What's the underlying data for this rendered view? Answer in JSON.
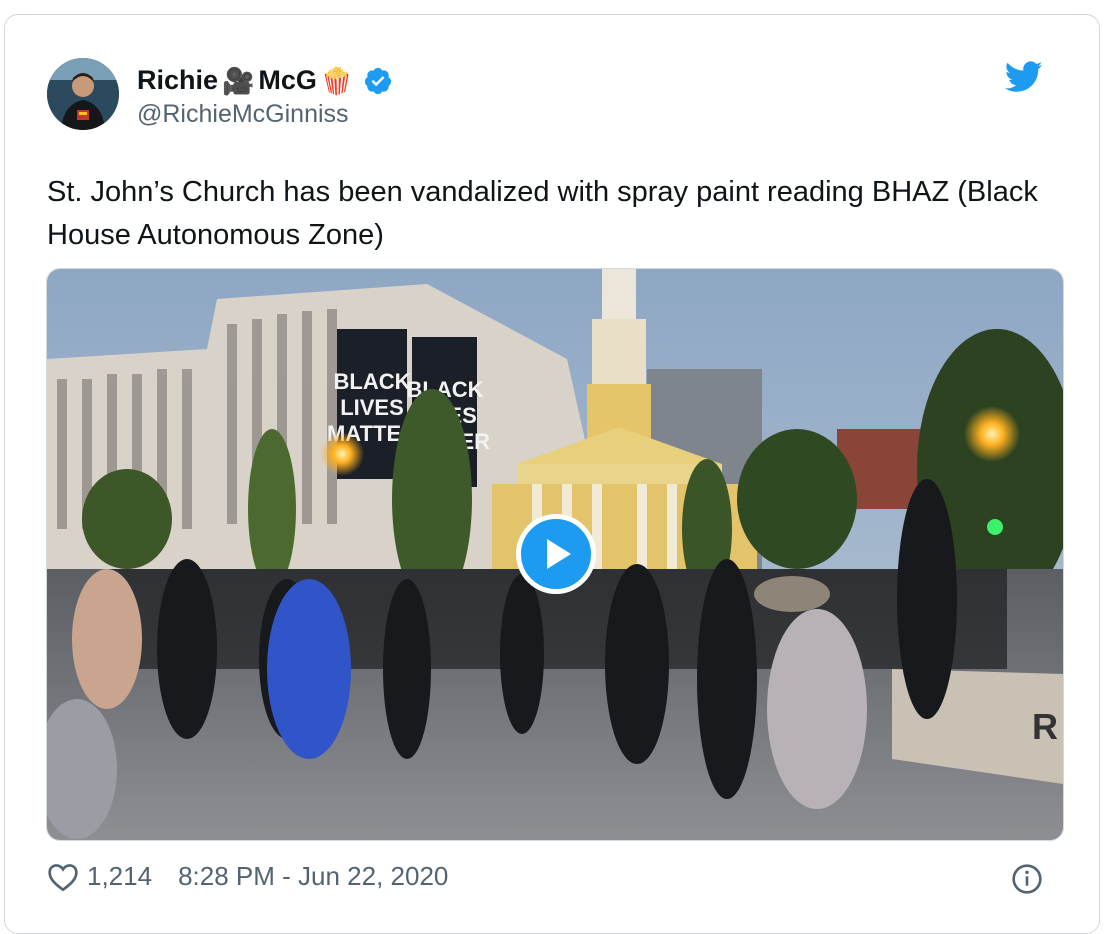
{
  "tweet": {
    "display_name": "Richie",
    "display_name_suffix": "McG",
    "emoji_camera": "🎥",
    "emoji_popcorn": "🍿",
    "handle": "@RichieMcGinniss",
    "text": "St. John’s Church has been vandalized with spray paint reading BHAZ (Black House Autonomous Zone)",
    "likes": "1,214",
    "timestamp": "8:28 PM - Jun 22, 2020"
  },
  "media": {
    "banner_line1": "BLACK",
    "banner_line2": "LIVES",
    "banner_line3": "MATTER",
    "barrier_text": "R"
  },
  "icons": {
    "verified": "verified-badge-icon",
    "bird": "twitter-bird-icon",
    "heart": "heart-icon",
    "info": "info-icon",
    "play": "play-icon"
  },
  "colors": {
    "accent": "#1d9bf0",
    "text": "#0f1419",
    "secondary": "#536471"
  }
}
